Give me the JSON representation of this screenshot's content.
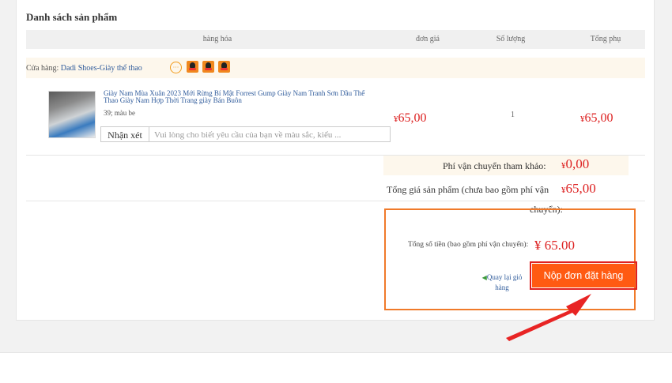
{
  "section_title": "Danh sách sản phẩm",
  "columns": [
    "hàng hóa",
    "đơn giá",
    "Số lượng",
    "Tổng phụ"
  ],
  "shop": {
    "label": "Cửa hàng:",
    "name": "Dadi Shoes-Giày thể thao"
  },
  "product": {
    "name": "Giày Nam Mùa Xuân 2023 Mới Rừng Bí Mật Forrest Gump Giày Nam Tranh Sơn Dầu Thể Thao Giày Nam Hợp Thời Trang giày Bán Buôn",
    "attributes": "39; màu be",
    "currency": "¥",
    "unit_price": "65,00",
    "quantity": "1",
    "subtotal": "65,00"
  },
  "comment": {
    "button_label": "Nhận xét",
    "placeholder": "Vui lòng cho biết yêu cầu của bạn về màu sắc, kiểu ..."
  },
  "shipping": {
    "label": "Phí vận chuyển tham khảo:",
    "currency": "¥",
    "value": "0,00"
  },
  "product_total": {
    "label": "Tổng giá sản phẩm (chưa bao gồm phí vận",
    "label_wrap": "chuyển):",
    "currency": "¥",
    "value": "65,00"
  },
  "grand_total": {
    "label": "Tổng số tiền (bao gồm phí vận chuyển):",
    "value": "¥ 65.00"
  },
  "back_link": {
    "arrow": "◀",
    "label": "Quay lại giỏ hàng"
  },
  "submit_button": "Nộp đơn đặt hàng",
  "colors": {
    "accent": "#ff5a12",
    "price": "#dd2222",
    "link": "#2f5b9b",
    "highlight": "#e02020"
  }
}
